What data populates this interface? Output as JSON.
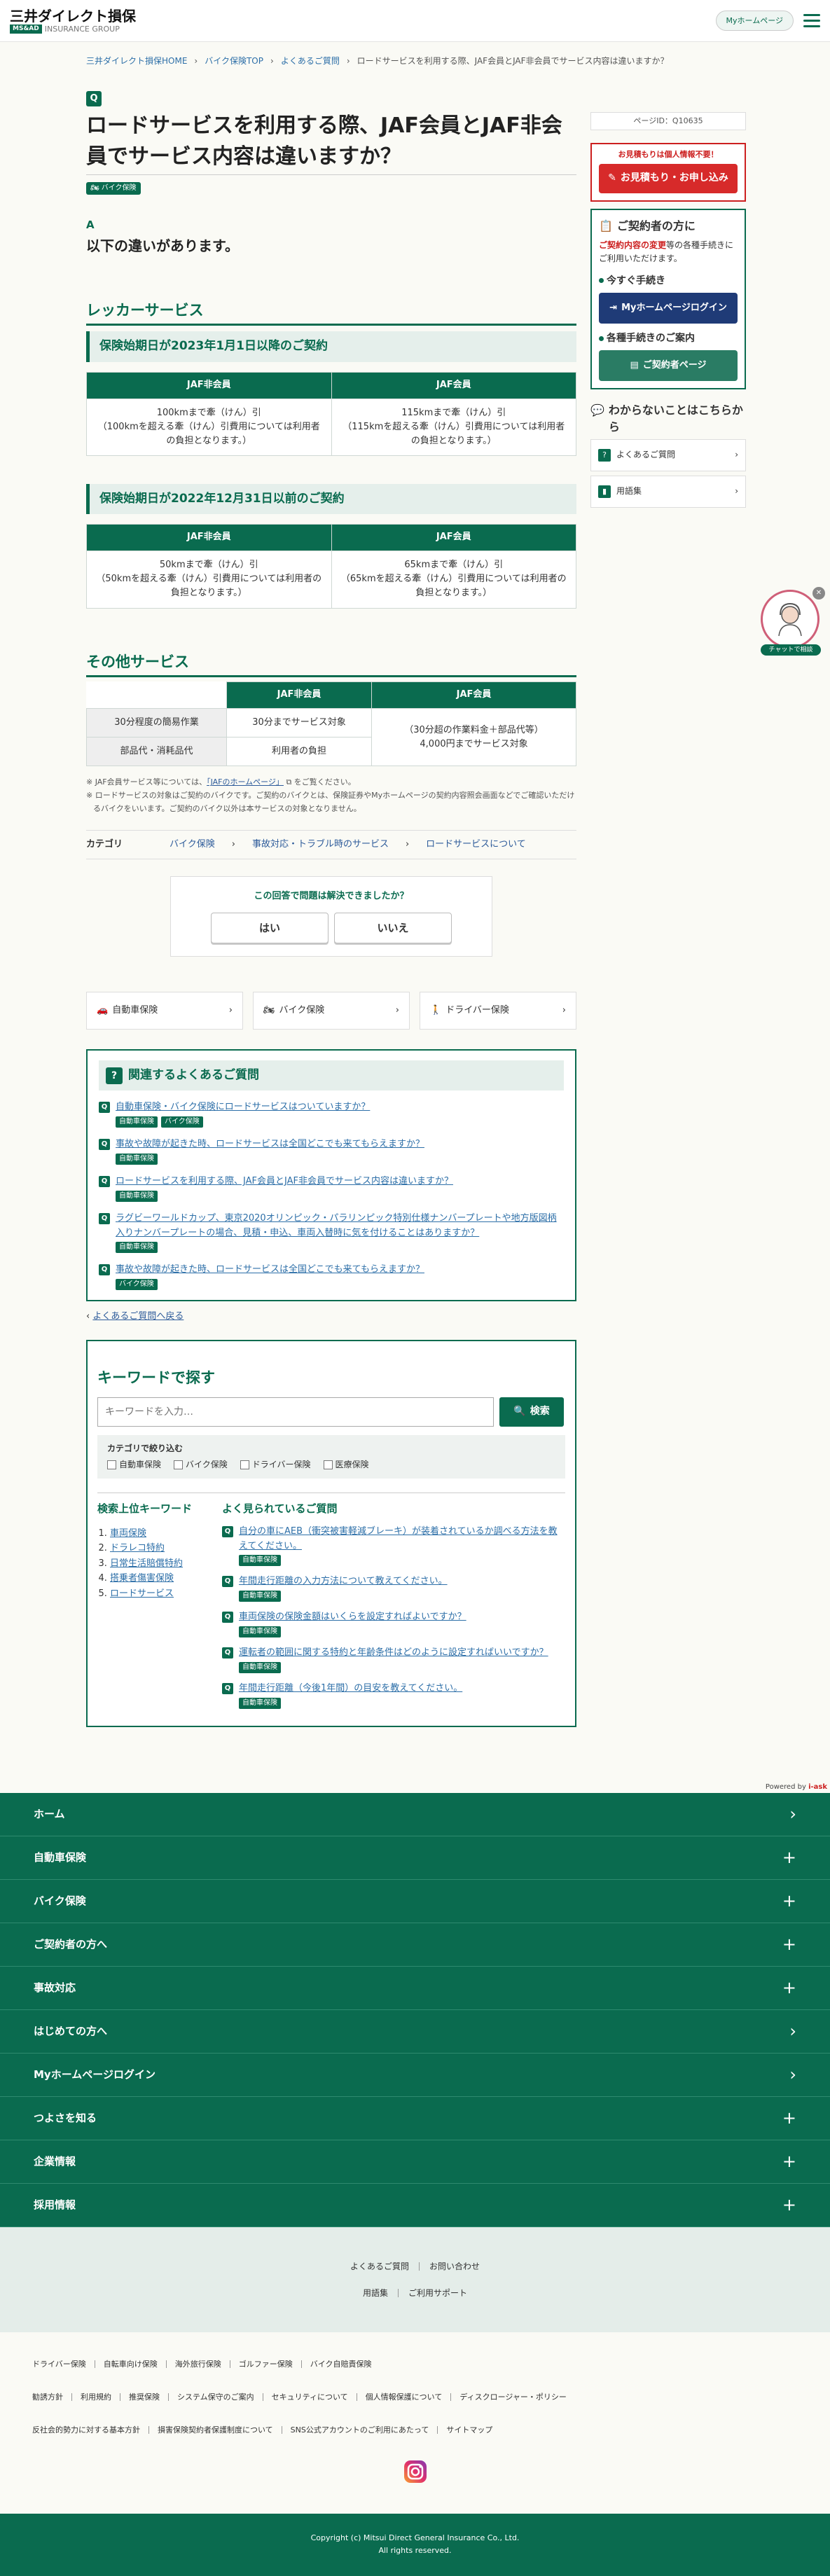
{
  "header": {
    "logo_name": "三井ダイレクト損保",
    "logo_badge": "MS&AD",
    "logo_group": "INSURANCE GROUP",
    "myhome_label": "Myホームページ"
  },
  "breadcrumb": [
    "三井ダイレクト損保HOME",
    "バイク保険TOP",
    "よくあるご質問",
    "ロードサービスを利用する際、JAF会員とJAF非会員でサービス内容は違いますか？"
  ],
  "question": {
    "badge": "Q",
    "title": "ロードサービスを利用する際、JAF会員とJAF非会員でサービス内容は違いますか？",
    "tag": "バイク保険"
  },
  "answer": {
    "badge": "A",
    "lead": "以下の違いがあります。"
  },
  "tow": {
    "heading": "レッカーサービス",
    "sub1": "保険始期日が2023年1月1日以降のご契約",
    "sub2": "保険始期日が2022年12月31日以前のご契約",
    "col_nonmember": "JAF非会員",
    "col_member": "JAF会員",
    "t1_non": "100kmまで牽（けん）引\n（100kmを超える牽（けん）引費用については利用者の負担となります。）",
    "t1_mem": "115kmまで牽（けん）引\n（115kmを超える牽（けん）引費用については利用者の負担となります。）",
    "t2_non": "50kmまで牽（けん）引\n（50kmを超える牽（けん）引費用については利用者の負担となります。）",
    "t2_mem": "65kmまで牽（けん）引\n（65kmを超える牽（けん）引費用については利用者の負担となります。）"
  },
  "other": {
    "heading": "その他サービス",
    "row1_label": "30分程度の簡易作業",
    "row1_non": "30分までサービス対象",
    "row2_label": "部品代・消耗品代",
    "row2_non": "利用者の負担",
    "member_merged": "（30分超の作業料金＋部品代等）\n4,000円までサービス対象"
  },
  "notes": {
    "n1_pre": "※ JAF会員サービス等については、",
    "n1_link": "「JAFのホームページ」",
    "n1_post": "をご覧ください。",
    "n2": "※ ロードサービスの対象はご契約のバイクです。ご契約のバイクとは、保険証券やMyホームページの契約内容照会画面などでご確認いただけるバイクをいいます。ご契約のバイク以外は本サービスの対象となりません。"
  },
  "category": {
    "label": "カテゴリ",
    "links": [
      "バイク保険",
      "事故対応・トラブル時のサービス",
      "ロードサービスについて"
    ]
  },
  "survey": {
    "question": "この回答で問題は解決できましたか？",
    "yes": "はい",
    "no": "いいえ"
  },
  "products": [
    "自動車保険",
    "バイク保険",
    "ドライバー保険"
  ],
  "related": {
    "heading": "関連するよくあるご質問",
    "items": [
      {
        "text": "自動車保険・バイク保険にロードサービスはついていますか？",
        "tags": [
          "自動車保険",
          "バイク保険"
        ]
      },
      {
        "text": "事故や故障が起きた時、ロードサービスは全国どこでも来てもらえますか？",
        "tags": [
          "自動車保険"
        ]
      },
      {
        "text": "ロードサービスを利用する際、JAF会員とJAF非会員でサービス内容は違いますか？",
        "tags": [
          "自動車保険"
        ]
      },
      {
        "text": "ラグビーワールドカップ、東京2020オリンピック・パラリンピック特別仕様ナンバープレートや地方版図柄入りナンバープレートの場合、見積・申込、車両入替時に気を付けることはありますか？",
        "tags": [
          "自動車保険"
        ]
      },
      {
        "text": "事故や故障が起きた時、ロードサービスは全国どこでも来てもらえますか？",
        "tags": [
          "バイク保険"
        ]
      }
    ]
  },
  "back_link": "よくあるご質問へ戻る",
  "keyword": {
    "heading": "キーワードで探す",
    "placeholder": "キーワードを入力…",
    "search_label": "検索",
    "filter_label": "カテゴリで絞り込む",
    "checks": [
      "自動車保険",
      "バイク保険",
      "ドライバー保険",
      "医療保険"
    ],
    "top_heading": "検索上位キーワード",
    "top_keywords": [
      "車両保険",
      "ドラレコ特約",
      "日常生活賠償特約",
      "搭乗者傷害保険",
      "ロードサービス"
    ],
    "popular_heading": "よく見られているご質問",
    "popular": [
      {
        "text": "自分の車にAEB（衝突被害軽減ブレーキ）が装着されているか調べる方法を教えてください。",
        "tag": "自動車保険"
      },
      {
        "text": "年間走行距離の入力方法について教えてください。",
        "tag": "自動車保険"
      },
      {
        "text": "車両保険の保険金額はいくらを設定すればよいですか？",
        "tag": "自動車保険"
      },
      {
        "text": "運転者の範囲に関する特約と年齢条件はどのように設定すればいいですか？",
        "tag": "自動車保険"
      },
      {
        "text": "年間走行距離（今後1年間）の目安を教えてください。",
        "tag": "自動車保険"
      }
    ]
  },
  "sidebar": {
    "page_id": "ページID：Q10635",
    "est_note": "お見積もりは個人情報不要！",
    "est_button": "お見積もり・お申し込み",
    "contract_heading": "ご契約者の方に",
    "contract_text_red": "ご契約内容の変更",
    "contract_text": "等の各種手続きにご利用いただけます。",
    "now_label": "今すぐ手続き",
    "login_button": "Myホームページログイン",
    "guide_label": "各種手続きのご案内",
    "contract_page_button": "ご契約者ページ",
    "help_heading": "わからないことはこちらから",
    "help_links": [
      "よくあるご質問",
      "用語集"
    ]
  },
  "chat": {
    "label": "チャットで相談"
  },
  "powered": {
    "prefix": "Powered by",
    "brand": "i-ask"
  },
  "footer_nav": [
    {
      "label": "ホーム",
      "icon": "chevron-right-icon"
    },
    {
      "label": "自動車保険",
      "icon": "plus-icon"
    },
    {
      "label": "バイク保険",
      "icon": "plus-icon"
    },
    {
      "label": "ご契約者の方へ",
      "icon": "plus-icon"
    },
    {
      "label": "事故対応",
      "icon": "plus-icon"
    },
    {
      "label": "はじめての方へ",
      "icon": "chevron-right-icon"
    },
    {
      "label": "Myホームページログイン",
      "icon": "chevron-right-icon"
    },
    {
      "label": "つよさを知る",
      "icon": "plus-icon"
    },
    {
      "label": "企業情報",
      "icon": "plus-icon"
    },
    {
      "label": "採用情報",
      "icon": "plus-icon"
    }
  ],
  "footer_links_row1": [
    "よくあるご質問",
    "お問い合わせ"
  ],
  "footer_links_row2": [
    "用語集",
    "ご利用サポート"
  ],
  "footer_small": [
    [
      "ドライバー保険",
      "自転車向け保険",
      "海外旅行保険",
      "ゴルファー保険",
      "バイク自賠責保険"
    ],
    [
      "勧誘方針",
      "利用規約",
      "推奨保険",
      "システム保守のご案内",
      "セキュリティについて",
      "個人情報保護について",
      "ディスクロージャー・ポリシー"
    ],
    [
      "反社会的勢力に対する基本方針",
      "損害保険契約者保護制度について",
      "SNS公式アカウントのご利用にあたって",
      "サイトマップ"
    ]
  ],
  "copyright": {
    "line1": "Copyright (c) Mitsui Direct General Insurance Co., Ltd.",
    "line2": "All rights reserved."
  }
}
